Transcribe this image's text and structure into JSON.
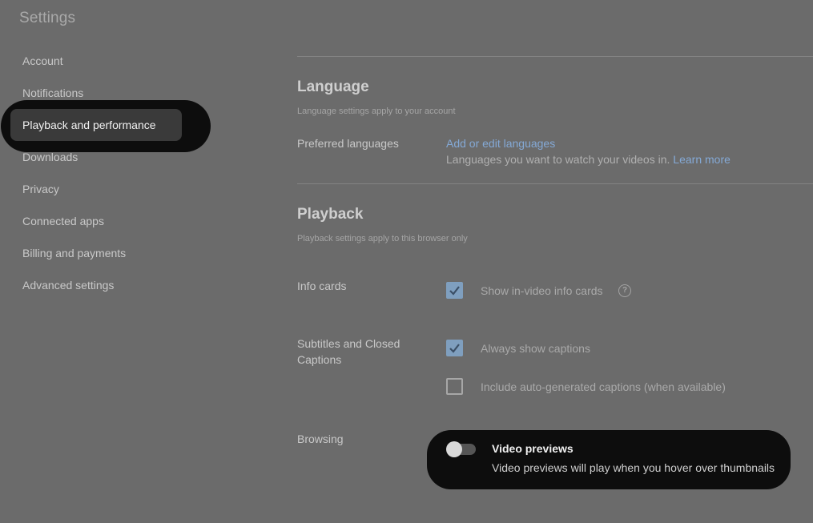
{
  "header": {
    "title": "Settings"
  },
  "sidebar": {
    "items": [
      {
        "label": "Account"
      },
      {
        "label": "Notifications"
      },
      {
        "label": "Playback and performance"
      },
      {
        "label": "Downloads"
      },
      {
        "label": "Privacy"
      },
      {
        "label": "Connected apps"
      },
      {
        "label": "Billing and payments"
      },
      {
        "label": "Advanced settings"
      }
    ],
    "active_index": 2
  },
  "language": {
    "title": "Language",
    "subtitle": "Language settings apply to your account",
    "preferred_label": "Preferred languages",
    "link": "Add or edit languages",
    "description": "Languages you want to watch your videos in.",
    "learn_more": "Learn more"
  },
  "playback": {
    "title": "Playback",
    "subtitle": "Playback settings apply to this browser only",
    "info_cards": {
      "label": "Info cards",
      "option": "Show in-video info cards",
      "checked": true,
      "help_icon": "question-circle-icon",
      "help_glyph": "?"
    },
    "captions": {
      "label": "Subtitles and Closed Captions",
      "options": [
        {
          "label": "Always show captions",
          "checked": true
        },
        {
          "label": "Include auto-generated captions (when available)",
          "checked": false
        }
      ]
    },
    "browsing": {
      "label": "Browsing",
      "toggle_title": "Video previews",
      "toggle_description": "Video previews will play when you hover over thumbnails",
      "toggle_on": false
    }
  },
  "colors": {
    "background": "#6b6b6b",
    "link": "#84a9d6",
    "checkbox_checked": "#7f9fbf",
    "highlight": "#0d0d0d"
  }
}
